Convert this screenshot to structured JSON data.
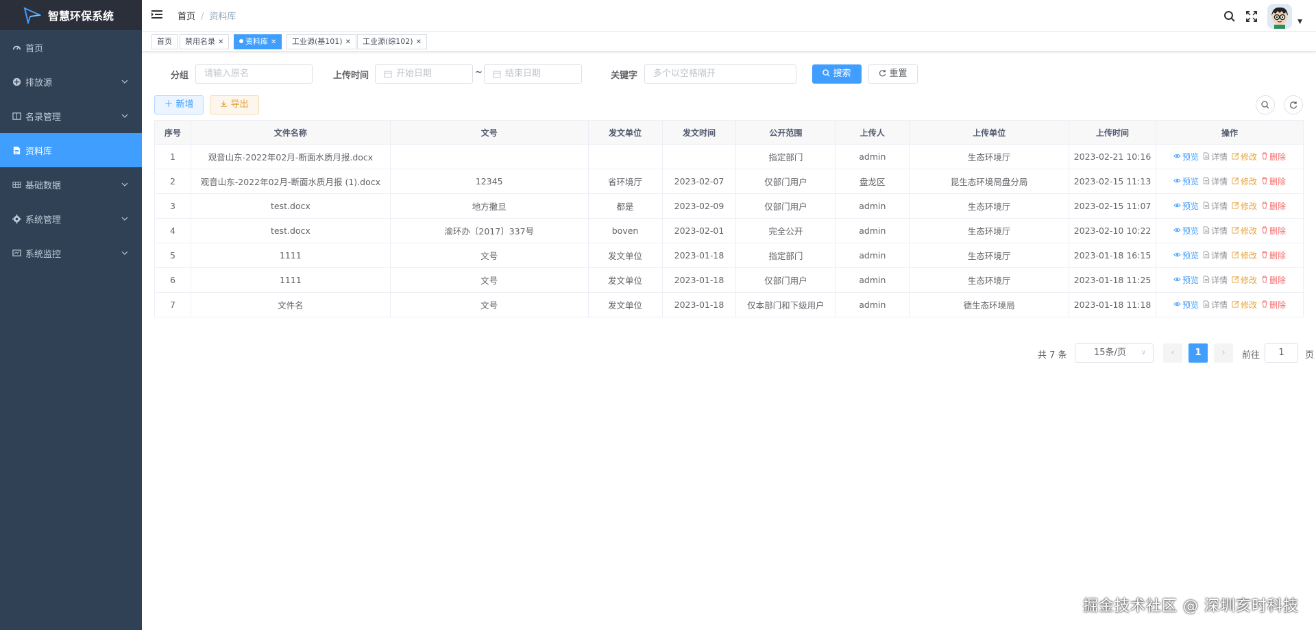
{
  "app": {
    "title": "智慧环保系统"
  },
  "sidebar": {
    "items": [
      {
        "label": "首页",
        "icon": "dashboard-icon",
        "expandable": false,
        "active": false
      },
      {
        "label": "排放源",
        "icon": "emission-icon",
        "expandable": true,
        "active": false
      },
      {
        "label": "名录管理",
        "icon": "directory-icon",
        "expandable": true,
        "active": false
      },
      {
        "label": "资料库",
        "icon": "document-icon",
        "expandable": false,
        "active": true
      },
      {
        "label": "基础数据",
        "icon": "grid-icon",
        "expandable": true,
        "active": false
      },
      {
        "label": "系统管理",
        "icon": "settings-icon",
        "expandable": true,
        "active": false
      },
      {
        "label": "系统监控",
        "icon": "monitor-icon",
        "expandable": true,
        "active": false
      }
    ]
  },
  "breadcrumb": {
    "home": "首页",
    "current": "资料库"
  },
  "tags": [
    {
      "label": "首页",
      "closable": false,
      "active": false
    },
    {
      "label": "禁用名录",
      "closable": true,
      "active": false
    },
    {
      "label": "资料库",
      "closable": true,
      "active": true
    },
    {
      "label": "工业源(基101)",
      "closable": true,
      "active": false
    },
    {
      "label": "工业源(综102)",
      "closable": true,
      "active": false
    }
  ],
  "search": {
    "group_label": "分组",
    "group_placeholder": "请输入原名",
    "upload_time_label": "上传时间",
    "start_placeholder": "开始日期",
    "range_sep": "~",
    "end_placeholder": "结束日期",
    "keyword_label": "关键字",
    "keyword_placeholder": "多个以空格隔开",
    "search_btn": "搜索",
    "reset_btn": "重置"
  },
  "toolbar": {
    "add_btn": "新增",
    "export_btn": "导出"
  },
  "table": {
    "headers": [
      "序号",
      "文件名称",
      "文号",
      "发文单位",
      "发文时间",
      "公开范围",
      "上传人",
      "上传单位",
      "上传时间",
      "操作"
    ],
    "rows": [
      [
        "1",
        "观音山东-2022年02月-断面水质月报.docx",
        "",
        "",
        "",
        "指定部门",
        "admin",
        "生态环境厅",
        "2023-02-21 10:16"
      ],
      [
        "2",
        "观音山东-2022年02月-断面水质月报 (1).docx",
        "12345",
        "省环境厅",
        "2023-02-07",
        "仅部门用户",
        "盘龙区",
        "昆生态环境局盘分局",
        "2023-02-15 11:13"
      ],
      [
        "3",
        "test.docx",
        "地方撒旦",
        "都是",
        "2023-02-09",
        "仅部门用户",
        "admin",
        "生态环境厅",
        "2023-02-15 11:07"
      ],
      [
        "4",
        "test.docx",
        "渝环办〔2017〕337号",
        "boven",
        "2023-02-01",
        "完全公开",
        "admin",
        "生态环境厅",
        "2023-02-10 10:22"
      ],
      [
        "5",
        "1111",
        "文号",
        "发文单位",
        "2023-01-18",
        "指定部门",
        "admin",
        "生态环境厅",
        "2023-01-18 16:15"
      ],
      [
        "6",
        "1111",
        "文号",
        "发文单位",
        "2023-01-18",
        "仅部门用户",
        "admin",
        "生态环境厅",
        "2023-01-18 11:25"
      ],
      [
        "7",
        "文件名",
        "文号",
        "发文单位",
        "2023-01-18",
        "仅本部门和下级用户",
        "admin",
        "德生态环境局",
        "2023-01-18 11:18"
      ]
    ],
    "actions": {
      "preview": "预览",
      "detail": "详情",
      "edit": "修改",
      "delete": "删除"
    }
  },
  "pagination": {
    "total": "共 7 条",
    "page_size": "15条/页",
    "current": "1",
    "goto_label": "前往",
    "goto_value": "1",
    "page_unit": "页"
  },
  "watermark": "掘金技术社区 @ 深圳亥时科技",
  "colors": {
    "sidebar": "#304156",
    "primary": "#409eff",
    "warning": "#e6a23c",
    "danger": "#f56c6c"
  }
}
